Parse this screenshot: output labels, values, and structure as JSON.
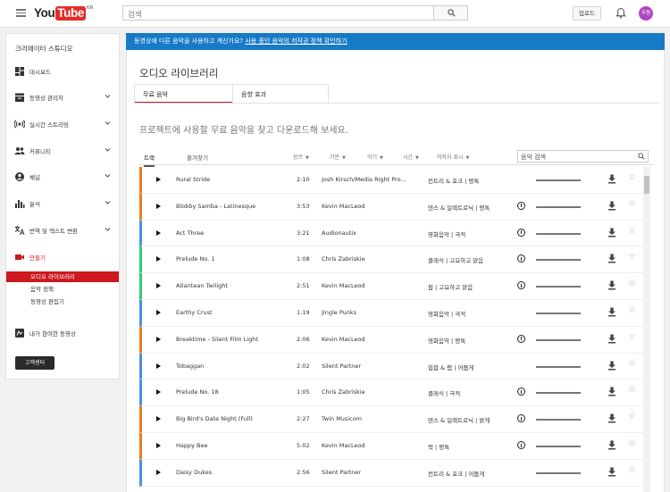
{
  "header": {
    "logo_you": "You",
    "logo_tube": "Tube",
    "logo_region": "KR",
    "search_placeholder": "검색",
    "upload_label": "업로드",
    "avatar_label": "우원"
  },
  "sidebar": {
    "title": "크리에이터 스튜디오",
    "items": [
      {
        "label": "대시보드",
        "icon": "dashboard-icon",
        "chevron": false
      },
      {
        "label": "동영상 관리자",
        "icon": "video-manager-icon",
        "chevron": true
      },
      {
        "label": "실시간 스트리밍",
        "icon": "live-stream-icon",
        "chevron": true
      },
      {
        "label": "커뮤니티",
        "icon": "community-icon",
        "chevron": true
      },
      {
        "label": "채널",
        "icon": "channel-icon",
        "chevron": true
      },
      {
        "label": "분석",
        "icon": "analytics-icon",
        "chevron": true
      },
      {
        "label": "번역 및 텍스트 변환",
        "icon": "translate-icon",
        "chevron": true
      },
      {
        "label": "만들기",
        "icon": "create-icon",
        "chevron": false
      }
    ],
    "create_sub": [
      "오디오 라이브러리",
      "음악 정책",
      "동영상 편집기"
    ],
    "contributed": "내가 참여한 동영상",
    "help_label": "고객센터"
  },
  "banner": {
    "text": "동영상에 다른 음악을 사용하고 계신가요?",
    "link": "사용 중인 음악의 저작권 정책 확인하기"
  },
  "page": {
    "title": "오디오 라이브러리",
    "tabs": [
      "무료 음악",
      "음향 효과"
    ],
    "intro": "프로젝트에 사용할 무료 음악을 찾고 다운로드해 보세요."
  },
  "filters": {
    "tabs": [
      "트랙",
      "즐겨찾기"
    ],
    "columns": [
      "장르",
      "기분",
      "악기",
      "시간",
      "저작자 표시"
    ],
    "search_placeholder": "음악 검색"
  },
  "tracks": [
    {
      "title": "Rural Stride",
      "duration": "2:10",
      "artist": "Josh Kirsch/Media Right Pro...",
      "genre": "컨트리 & 포크 | 평톡",
      "attribution": false,
      "color": "#e67e22"
    },
    {
      "title": "Blobby Samba - Latinesque",
      "duration": "3:53",
      "artist": "Kevin MacLeod",
      "genre": "댄스 & 일렉트로닉 | 평톡",
      "attribution": true,
      "color": "#e67e22"
    },
    {
      "title": "Act Three",
      "duration": "3:21",
      "artist": "Audionautix",
      "genre": "영화음악 | 극적",
      "attribution": true,
      "color": "#4a90e2"
    },
    {
      "title": "Prelude No. 1",
      "duration": "1:08",
      "artist": "Chris Zabriskie",
      "genre": "클래식 | 고요하고 맑음",
      "attribution": true,
      "color": "#2ecc71"
    },
    {
      "title": "Atlantean Twilight",
      "duration": "2:51",
      "artist": "Kevin MacLeod",
      "genre": "팝 | 고요하고 맑음",
      "attribution": true,
      "color": "#2ecc71"
    },
    {
      "title": "Earthy Crust",
      "duration": "1:19",
      "artist": "Jingle Punks",
      "genre": "영화음악 | 극적",
      "attribution": false,
      "color": "#4a90e2"
    },
    {
      "title": "Breaktime - Silent Film Light",
      "duration": "2:06",
      "artist": "Kevin MacLeod",
      "genre": "영화음악 | 평톡",
      "attribution": true,
      "color": "#e67e22"
    },
    {
      "title": "Tobaggan",
      "duration": "2:02",
      "artist": "Silent Partner",
      "genre": "힙합 & 랩 | 어둡게",
      "attribution": false,
      "color": "#4a90e2"
    },
    {
      "title": "Prelude No. 18",
      "duration": "1:05",
      "artist": "Chris Zabriskie",
      "genre": "클래식 | 극적",
      "attribution": true,
      "color": "#4a90e2"
    },
    {
      "title": "Big Bird's Date Night (Full)",
      "duration": "2:27",
      "artist": "Twin Musicom",
      "genre": "댄스 & 일렉트로닉 | 밝게",
      "attribution": true,
      "color": "#e67e22"
    },
    {
      "title": "Happy Bee",
      "duration": "5:02",
      "artist": "Kevin MacLeod",
      "genre": "락 | 평톡",
      "attribution": true,
      "color": "#e67e22"
    },
    {
      "title": "Daisy Dukes",
      "duration": "2:56",
      "artist": "Silent Partner",
      "genre": "컨트리 & 포크 | 어둡게",
      "attribution": false,
      "color": "#4a90e2"
    }
  ]
}
